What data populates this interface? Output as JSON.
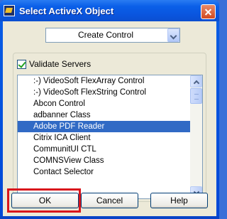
{
  "window": {
    "title": "Select ActiveX Object",
    "icon": "labview-app-icon",
    "close_icon": "close-icon"
  },
  "dropdown": {
    "value": "Create Control",
    "arrow_icon": "chevron-down-icon"
  },
  "validate": {
    "label": "Validate Servers",
    "checked": true
  },
  "list": {
    "items": [
      ":-) VideoSoft FlexArray Control",
      ":-) VideoSoft FlexString Control",
      "Abcon Control",
      "adbanner Class",
      "Adobe PDF Reader",
      "Citrix ICA Client",
      "CommunitUI CTL",
      "COMNSView Class",
      "Contact Selector"
    ],
    "selected": "Adobe PDF Reader"
  },
  "buttons": {
    "ok": "OK",
    "cancel": "Cancel",
    "help": "Help"
  },
  "annotation": {
    "highlight_color": "#d9151c"
  }
}
